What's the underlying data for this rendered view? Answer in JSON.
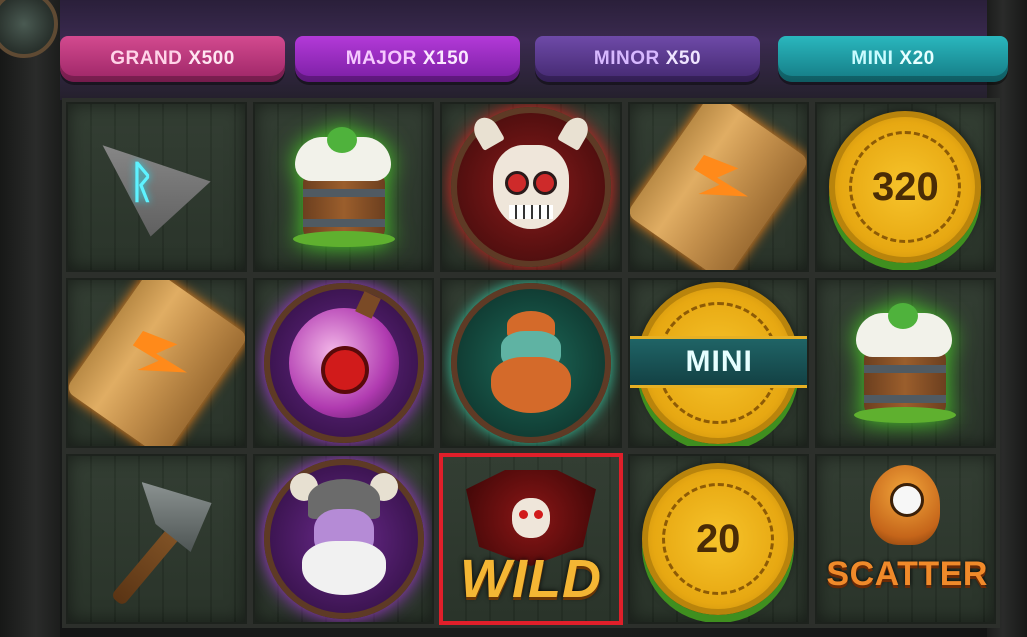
{
  "jackpots": [
    {
      "name": "GRAND",
      "multiplier": "X500"
    },
    {
      "name": "MAJOR",
      "multiplier": "X150"
    },
    {
      "name": "MINOR",
      "multiplier": "X50"
    },
    {
      "name": "MINI",
      "multiplier": "X20"
    }
  ],
  "reels": {
    "row1": {
      "c1": {
        "symbol": "rune-stone"
      },
      "c2": {
        "symbol": "ale-mug"
      },
      "c3": {
        "symbol": "skull-warrior"
      },
      "c4": {
        "symbol": "wooden-plank"
      },
      "c5": {
        "symbol": "gold-coin",
        "value": "320"
      }
    },
    "row2": {
      "c1": {
        "symbol": "wooden-plank"
      },
      "c2": {
        "symbol": "eye-potion"
      },
      "c3": {
        "symbol": "dwarf"
      },
      "c4": {
        "symbol": "mini-coin",
        "label": "MINI"
      },
      "c5": {
        "symbol": "ale-mug"
      }
    },
    "row3": {
      "c1": {
        "symbol": "axe"
      },
      "c2": {
        "symbol": "viking-zombie"
      },
      "c3": {
        "symbol": "wild",
        "label": "WILD",
        "selected": true
      },
      "c4": {
        "symbol": "gold-coin",
        "value": "20"
      },
      "c5": {
        "symbol": "scatter",
        "label": "SCATTER"
      }
    }
  },
  "colors": {
    "selection_border": "#e01f2a",
    "grand": "#c23d80",
    "major": "#a52fcf",
    "minor": "#5c3c91",
    "mini": "#22a6ad"
  }
}
